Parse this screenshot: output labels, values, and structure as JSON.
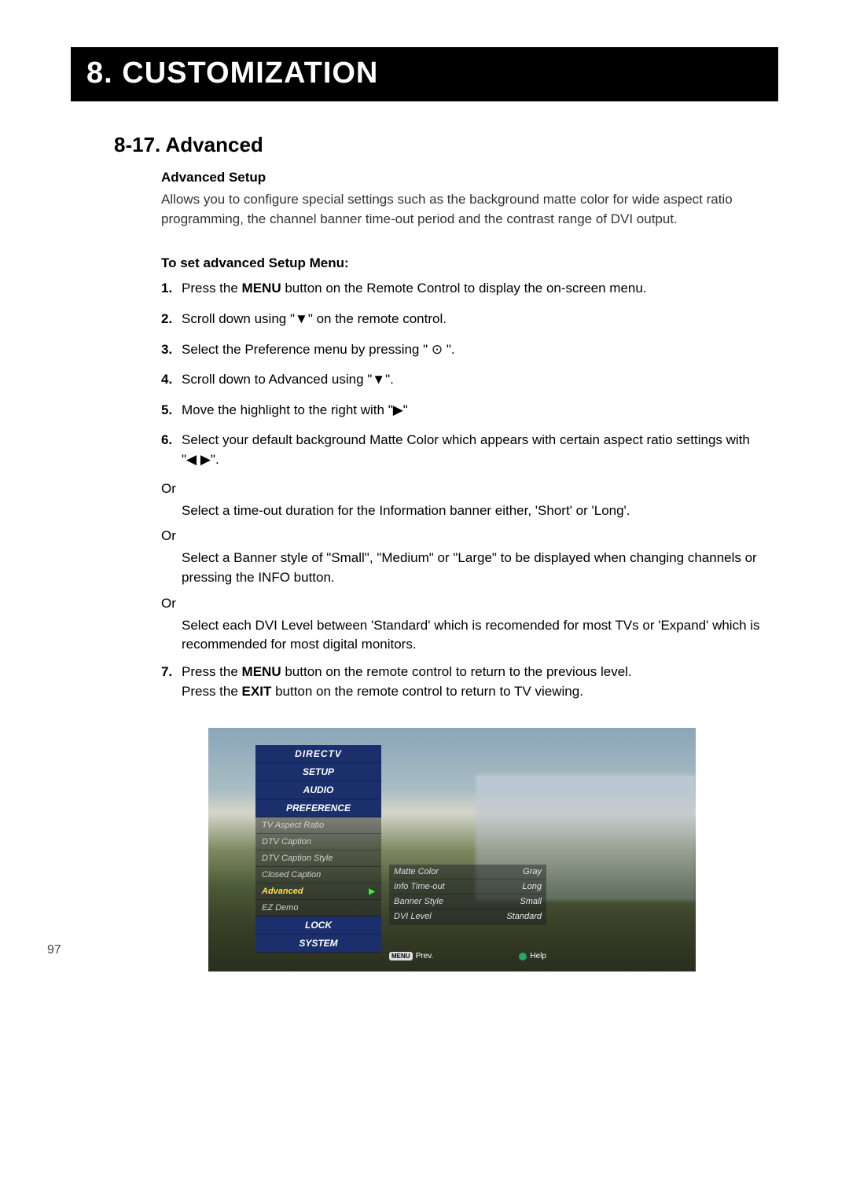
{
  "header": {
    "title": "8. CUSTOMIZATION"
  },
  "section": {
    "num_title": "8-17. Advanced",
    "sub1_head": "Advanced Setup",
    "sub1_body": "Allows you to configure special settings such as the background matte color for wide aspect ratio programming, the channel banner time-out period and the contrast range of DVI output.",
    "sub2_head": "To set advanced Setup Menu:",
    "steps": {
      "s1_num": "1.",
      "s1_a": "Press the ",
      "s1_b": "MENU",
      "s1_c": " button on the Remote Control to display the on-screen menu.",
      "s2_num": "2.",
      "s2": "Scroll down using \"▼\" on the remote control.",
      "s3_num": "3.",
      "s3": "Select the Preference menu by pressing \" ⊙ \".",
      "s4_num": "4.",
      "s4": "Scroll down to Advanced using \"▼\".",
      "s5_num": "5.",
      "s5": "Move the highlight to the right with \"▶\"",
      "s6_num": "6.",
      "s6": "Select your default background Matte Color which appears with certain aspect ratio settings with \"◀ ▶\".",
      "or": "Or",
      "alt1": "Select a time-out duration for the Information banner either, 'Short' or 'Long'.",
      "alt2": "Select a Banner style of \"Small\", \"Medium\" or \"Large\" to be displayed when changing channels or pressing the INFO button.",
      "alt3": "Select each DVI Level between 'Standard' which is recomended for most TVs or 'Expand' which is recommended for most digital monitors.",
      "s7_num": "7.",
      "s7_a": "Press the ",
      "s7_b": "MENU",
      "s7_c": " button on the remote control to return to the previous level.",
      "s7_d": "Press the ",
      "s7_e": "EXIT",
      "s7_f": " button on the remote control to return to TV viewing."
    }
  },
  "page_number": "97",
  "tv": {
    "brand": "DIRECTV",
    "cats": {
      "setup": "SETUP",
      "audio": "AUDIO",
      "pref": "PREFERENCE",
      "lock": "LOCK",
      "system": "SYSTEM"
    },
    "pref_items": {
      "aspect": "TV Aspect Ratio",
      "dtvcap": "DTV Caption",
      "dtvcapstyle": "DTV Caption Style",
      "cc": "Closed Caption",
      "adv": "Advanced",
      "ez": "EZ Demo"
    },
    "settings": {
      "matte_l": "Matte Color",
      "matte_v": "Gray",
      "info_l": "Info Time-out",
      "info_v": "Long",
      "banner_l": "Banner Style",
      "banner_v": "Small",
      "dvi_l": "DVI Level",
      "dvi_v": "Standard"
    },
    "footer": {
      "prev_pill": "MENU",
      "prev": "Prev.",
      "help": "Help"
    }
  }
}
